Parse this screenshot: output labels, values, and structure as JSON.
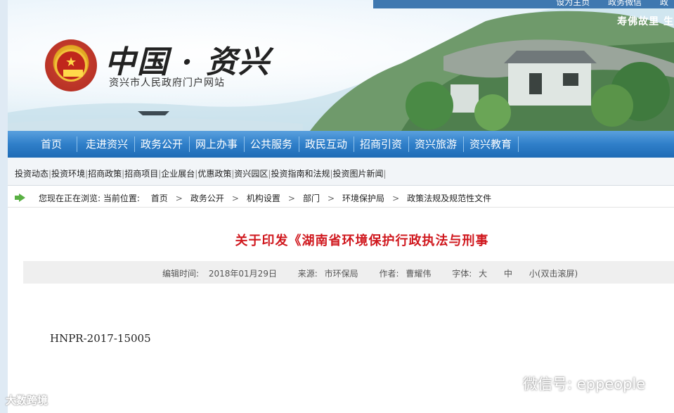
{
  "header": {
    "top_links": [
      "设为主页",
      "政务微信",
      "政"
    ],
    "slogan": "寿佛故里 生",
    "logo_text": "中国 · 资兴",
    "site_name": "资兴市人民政府门户网站"
  },
  "nav": {
    "items": [
      "首页",
      "走进资兴",
      "政务公开",
      "网上办事",
      "公共服务",
      "政民互动",
      "招商引资",
      "资兴旅游",
      "资兴教育"
    ]
  },
  "subnav": {
    "items": [
      "投资动态",
      "投资环境",
      "招商政策",
      "招商项目",
      "企业展台",
      "优惠政策",
      "资兴园区",
      "投资指南和法规",
      "投资图片新闻"
    ]
  },
  "breadcrumb": {
    "prefix": "您现在正在浏览: 当前位置:",
    "items": [
      "首页",
      "政务公开",
      "机构设置",
      "部门",
      "环境保护局",
      "政策法规及规范性文件"
    ]
  },
  "article": {
    "title": "关于印发《湖南省环境保护行政执法与刑事",
    "meta": {
      "date_label": "编辑时间:",
      "date": "2018年01月29日",
      "source_label": "来源:",
      "source": "市环保局",
      "author_label": "作者:",
      "author": "曹耀伟",
      "font_label": "字体:",
      "font_large": "大",
      "font_medium": "中",
      "font_small": "小(双击滚屏)"
    },
    "doc_number": "HNPR-2017-15005"
  },
  "watermarks": {
    "left": "大数跨境",
    "right": "微信号: eppeople"
  },
  "colors": {
    "nav_blue": "#2f7fc9",
    "title_red": "#d0181e",
    "arrow_green": "#59b043"
  }
}
